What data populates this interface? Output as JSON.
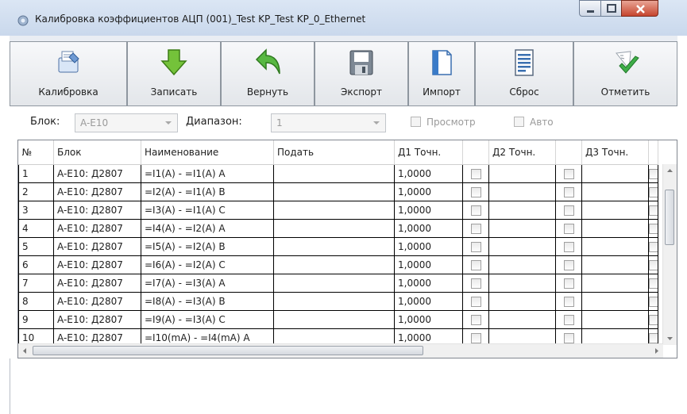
{
  "window": {
    "title": "Калибровка коэффициентов АЦП (001)_Test KP_Test KP_0_Ethernet"
  },
  "toolbar": {
    "buttons": [
      {
        "label": "Калибровка",
        "icon": "calibrate-icon"
      },
      {
        "label": "Записать",
        "icon": "arrow-down-icon"
      },
      {
        "label": "Вернуть",
        "icon": "undo-arrow-icon"
      },
      {
        "label": "Экспорт",
        "icon": "floppy-disk-icon"
      },
      {
        "label": "Импорт",
        "icon": "document-import-icon"
      },
      {
        "label": "Сброс",
        "icon": "reset-document-icon"
      },
      {
        "label": "Отметить",
        "icon": "checkmark-icon"
      }
    ]
  },
  "filters": {
    "block_label": "Блок:",
    "block_value": "A-E10",
    "range_label": "Диапазон:",
    "range_value": "1",
    "preview_label": "Просмотр",
    "auto_label": "Авто"
  },
  "grid": {
    "columns": [
      "№",
      "Блок",
      "Наименование",
      "Подать",
      "Д1 Точн.",
      "",
      "Д2 Точн.",
      "",
      "Д3 Точн.",
      ""
    ],
    "rows": [
      {
        "n": "1",
        "block": "A-E10: Д2807",
        "name": "=I1(A) - =I1(A) A",
        "give": "",
        "d1": "1,0000"
      },
      {
        "n": "2",
        "block": "A-E10: Д2807",
        "name": "=I2(A) - =I1(A) B",
        "give": "",
        "d1": "1,0000"
      },
      {
        "n": "3",
        "block": "A-E10: Д2807",
        "name": "=I3(A) - =I1(A) C",
        "give": "",
        "d1": "1,0000"
      },
      {
        "n": "4",
        "block": "A-E10: Д2807",
        "name": "=I4(A) - =I2(A) A",
        "give": "",
        "d1": "1,0000"
      },
      {
        "n": "5",
        "block": "A-E10: Д2807",
        "name": "=I5(A) - =I2(A) B",
        "give": "",
        "d1": "1,0000"
      },
      {
        "n": "6",
        "block": "A-E10: Д2807",
        "name": "=I6(A) - =I2(A) C",
        "give": "",
        "d1": "1,0000"
      },
      {
        "n": "7",
        "block": "A-E10: Д2807",
        "name": "=I7(A) - =I3(A) A",
        "give": "",
        "d1": "1,0000"
      },
      {
        "n": "8",
        "block": "A-E10: Д2807",
        "name": "=I8(A) - =I3(A) B",
        "give": "",
        "d1": "1,0000"
      },
      {
        "n": "9",
        "block": "A-E10: Д2807",
        "name": "=I9(A) - =I3(A) C",
        "give": "",
        "d1": "1,0000"
      },
      {
        "n": "10",
        "block": "A-E10: Д2807",
        "name": "=I10(mA) - =I4(mA) A",
        "give": "",
        "d1": "1,0000"
      }
    ]
  }
}
